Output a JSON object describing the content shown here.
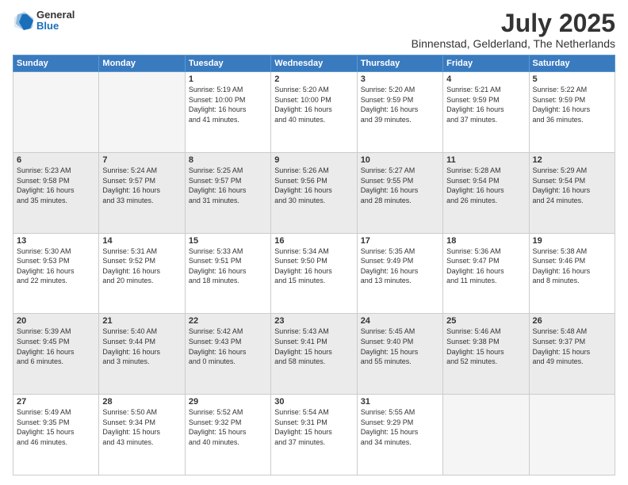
{
  "header": {
    "logo": {
      "general": "General",
      "blue": "Blue"
    },
    "title": "July 2025",
    "location": "Binnenstad, Gelderland, The Netherlands"
  },
  "weekdays": [
    "Sunday",
    "Monday",
    "Tuesday",
    "Wednesday",
    "Thursday",
    "Friday",
    "Saturday"
  ],
  "weeks": [
    [
      {
        "day": "",
        "info": ""
      },
      {
        "day": "",
        "info": ""
      },
      {
        "day": "1",
        "info": "Sunrise: 5:19 AM\nSunset: 10:00 PM\nDaylight: 16 hours\nand 41 minutes."
      },
      {
        "day": "2",
        "info": "Sunrise: 5:20 AM\nSunset: 10:00 PM\nDaylight: 16 hours\nand 40 minutes."
      },
      {
        "day": "3",
        "info": "Sunrise: 5:20 AM\nSunset: 9:59 PM\nDaylight: 16 hours\nand 39 minutes."
      },
      {
        "day": "4",
        "info": "Sunrise: 5:21 AM\nSunset: 9:59 PM\nDaylight: 16 hours\nand 37 minutes."
      },
      {
        "day": "5",
        "info": "Sunrise: 5:22 AM\nSunset: 9:59 PM\nDaylight: 16 hours\nand 36 minutes."
      }
    ],
    [
      {
        "day": "6",
        "info": "Sunrise: 5:23 AM\nSunset: 9:58 PM\nDaylight: 16 hours\nand 35 minutes."
      },
      {
        "day": "7",
        "info": "Sunrise: 5:24 AM\nSunset: 9:57 PM\nDaylight: 16 hours\nand 33 minutes."
      },
      {
        "day": "8",
        "info": "Sunrise: 5:25 AM\nSunset: 9:57 PM\nDaylight: 16 hours\nand 31 minutes."
      },
      {
        "day": "9",
        "info": "Sunrise: 5:26 AM\nSunset: 9:56 PM\nDaylight: 16 hours\nand 30 minutes."
      },
      {
        "day": "10",
        "info": "Sunrise: 5:27 AM\nSunset: 9:55 PM\nDaylight: 16 hours\nand 28 minutes."
      },
      {
        "day": "11",
        "info": "Sunrise: 5:28 AM\nSunset: 9:54 PM\nDaylight: 16 hours\nand 26 minutes."
      },
      {
        "day": "12",
        "info": "Sunrise: 5:29 AM\nSunset: 9:54 PM\nDaylight: 16 hours\nand 24 minutes."
      }
    ],
    [
      {
        "day": "13",
        "info": "Sunrise: 5:30 AM\nSunset: 9:53 PM\nDaylight: 16 hours\nand 22 minutes."
      },
      {
        "day": "14",
        "info": "Sunrise: 5:31 AM\nSunset: 9:52 PM\nDaylight: 16 hours\nand 20 minutes."
      },
      {
        "day": "15",
        "info": "Sunrise: 5:33 AM\nSunset: 9:51 PM\nDaylight: 16 hours\nand 18 minutes."
      },
      {
        "day": "16",
        "info": "Sunrise: 5:34 AM\nSunset: 9:50 PM\nDaylight: 16 hours\nand 15 minutes."
      },
      {
        "day": "17",
        "info": "Sunrise: 5:35 AM\nSunset: 9:49 PM\nDaylight: 16 hours\nand 13 minutes."
      },
      {
        "day": "18",
        "info": "Sunrise: 5:36 AM\nSunset: 9:47 PM\nDaylight: 16 hours\nand 11 minutes."
      },
      {
        "day": "19",
        "info": "Sunrise: 5:38 AM\nSunset: 9:46 PM\nDaylight: 16 hours\nand 8 minutes."
      }
    ],
    [
      {
        "day": "20",
        "info": "Sunrise: 5:39 AM\nSunset: 9:45 PM\nDaylight: 16 hours\nand 6 minutes."
      },
      {
        "day": "21",
        "info": "Sunrise: 5:40 AM\nSunset: 9:44 PM\nDaylight: 16 hours\nand 3 minutes."
      },
      {
        "day": "22",
        "info": "Sunrise: 5:42 AM\nSunset: 9:43 PM\nDaylight: 16 hours\nand 0 minutes."
      },
      {
        "day": "23",
        "info": "Sunrise: 5:43 AM\nSunset: 9:41 PM\nDaylight: 15 hours\nand 58 minutes."
      },
      {
        "day": "24",
        "info": "Sunrise: 5:45 AM\nSunset: 9:40 PM\nDaylight: 15 hours\nand 55 minutes."
      },
      {
        "day": "25",
        "info": "Sunrise: 5:46 AM\nSunset: 9:38 PM\nDaylight: 15 hours\nand 52 minutes."
      },
      {
        "day": "26",
        "info": "Sunrise: 5:48 AM\nSunset: 9:37 PM\nDaylight: 15 hours\nand 49 minutes."
      }
    ],
    [
      {
        "day": "27",
        "info": "Sunrise: 5:49 AM\nSunset: 9:35 PM\nDaylight: 15 hours\nand 46 minutes."
      },
      {
        "day": "28",
        "info": "Sunrise: 5:50 AM\nSunset: 9:34 PM\nDaylight: 15 hours\nand 43 minutes."
      },
      {
        "day": "29",
        "info": "Sunrise: 5:52 AM\nSunset: 9:32 PM\nDaylight: 15 hours\nand 40 minutes."
      },
      {
        "day": "30",
        "info": "Sunrise: 5:54 AM\nSunset: 9:31 PM\nDaylight: 15 hours\nand 37 minutes."
      },
      {
        "day": "31",
        "info": "Sunrise: 5:55 AM\nSunset: 9:29 PM\nDaylight: 15 hours\nand 34 minutes."
      },
      {
        "day": "",
        "info": ""
      },
      {
        "day": "",
        "info": ""
      }
    ]
  ]
}
